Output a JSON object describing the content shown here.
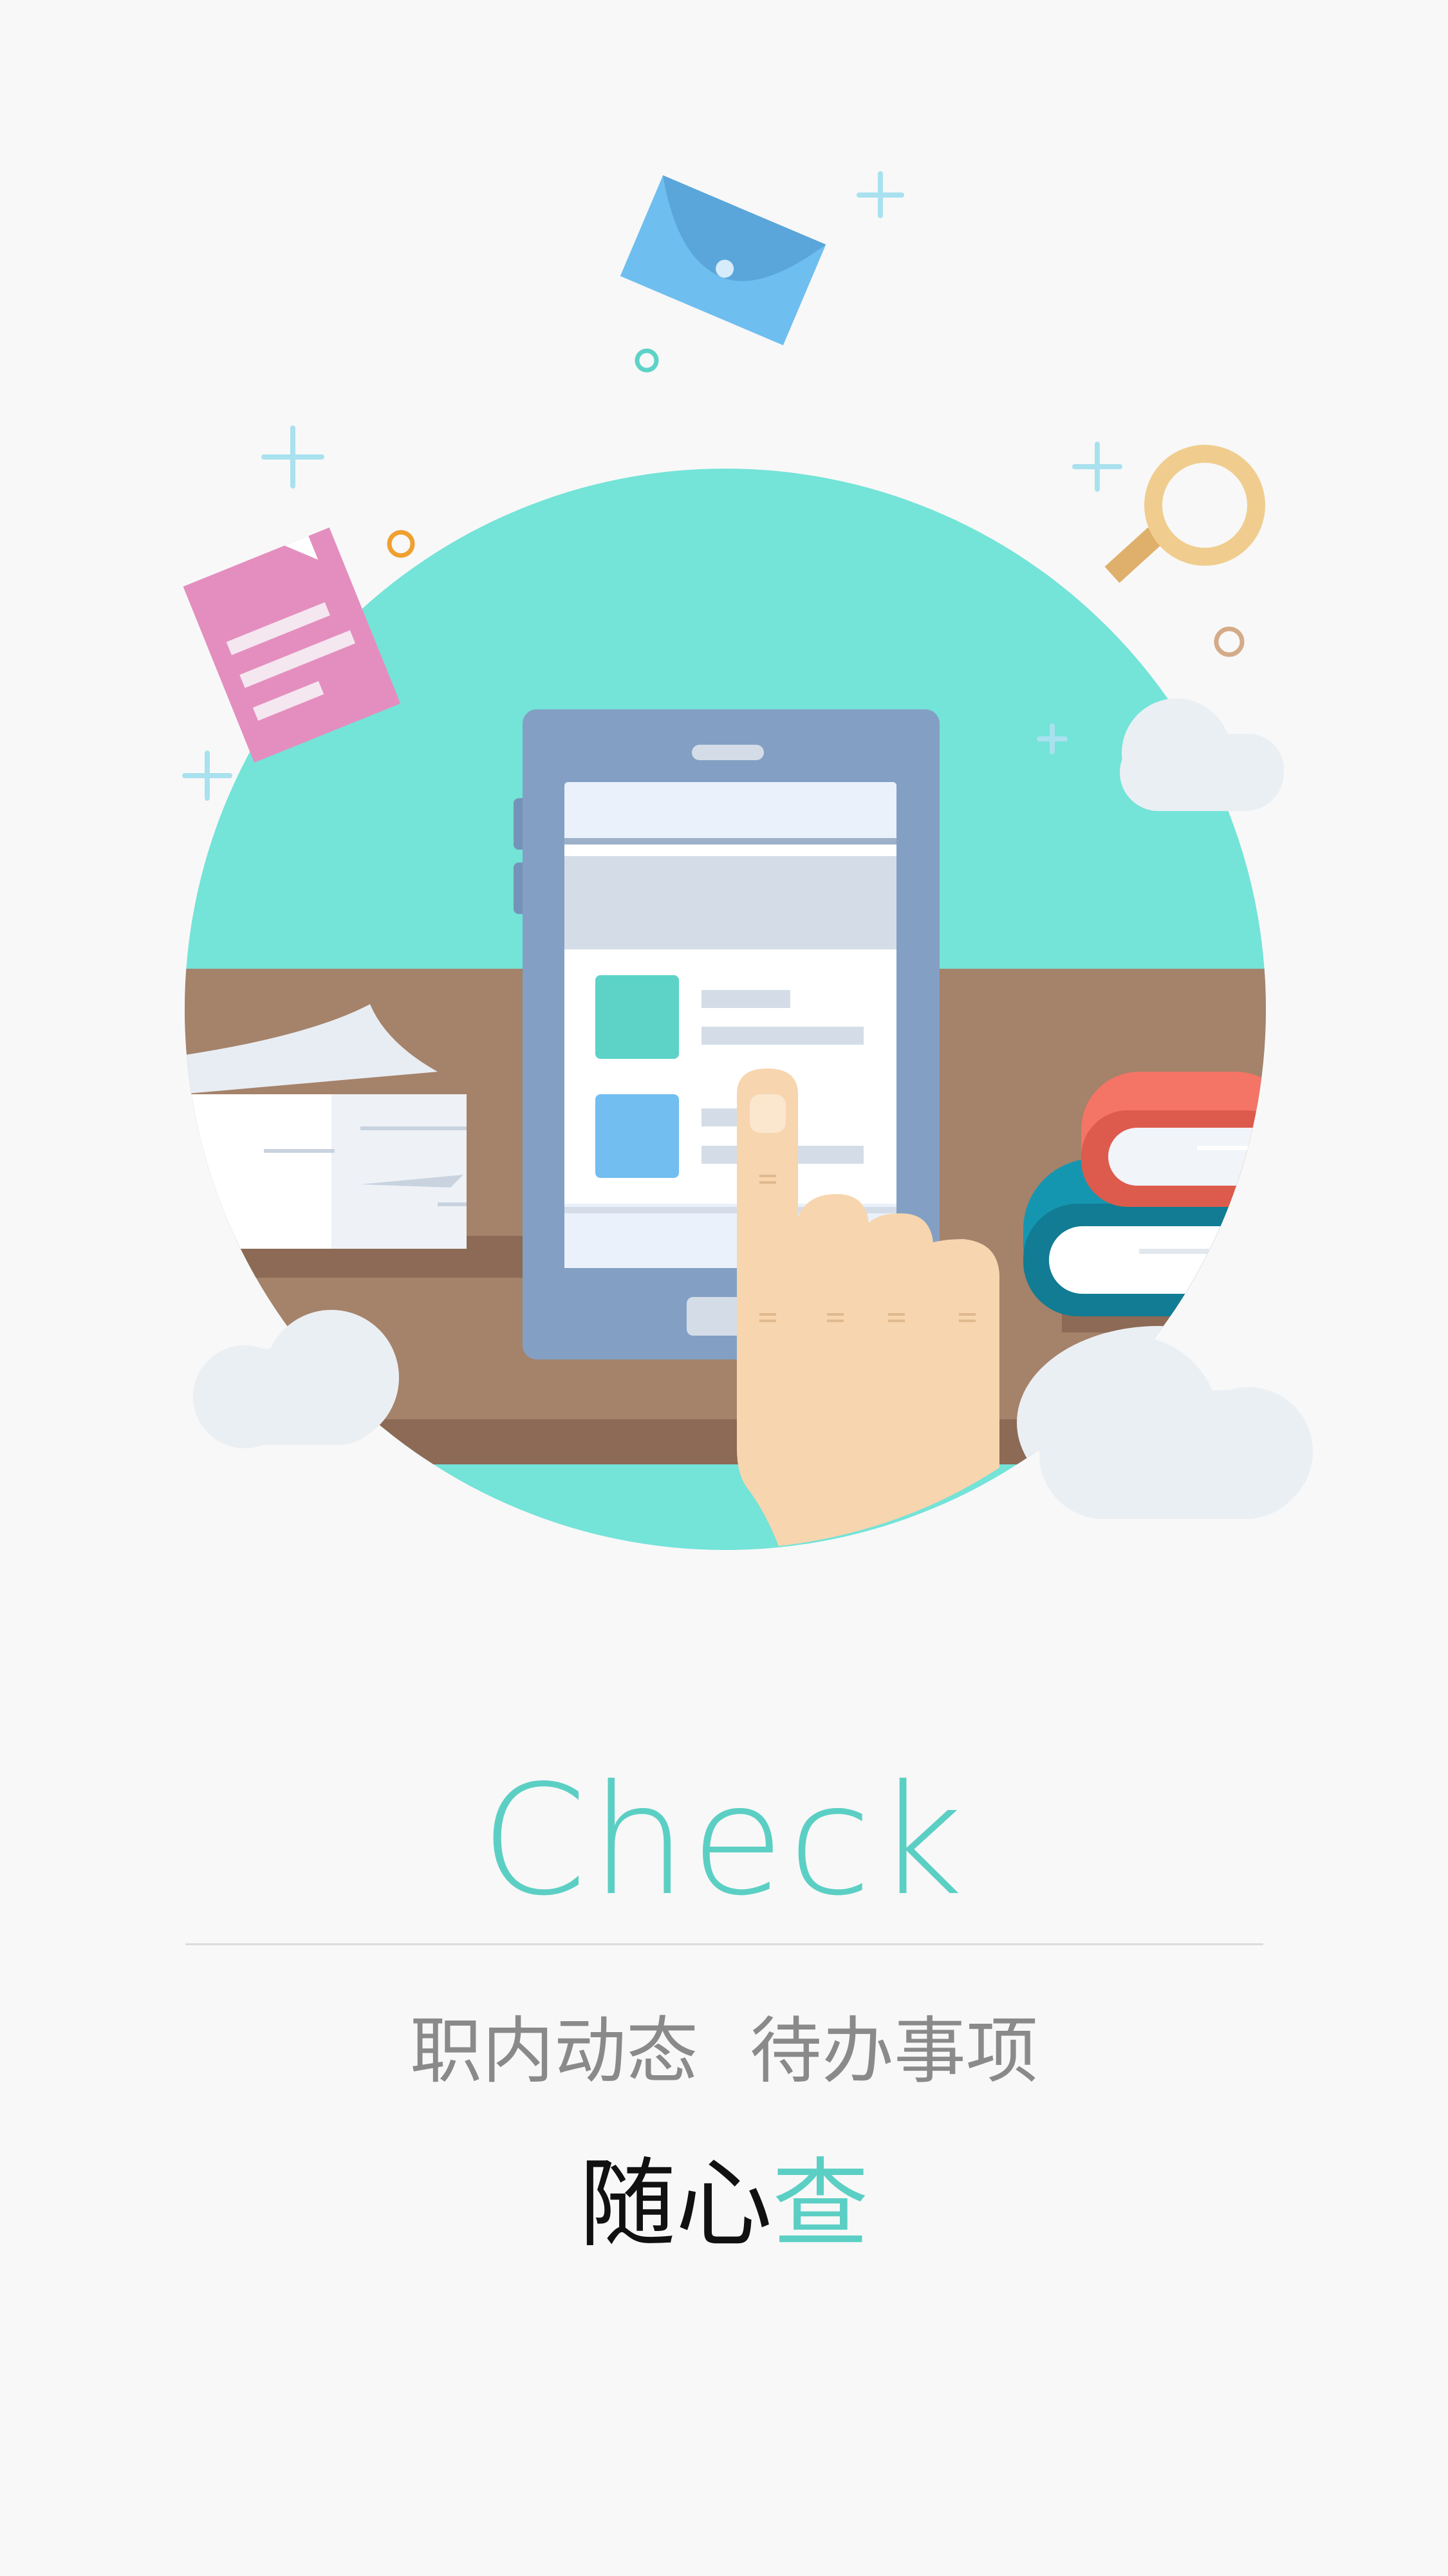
{
  "illustration": {
    "icons": [
      "envelope-icon",
      "document-icon",
      "magnifier-icon",
      "smartphone-icon",
      "pointing-hand-icon",
      "books-icon",
      "cloud-icon",
      "plus-sparkle-icon"
    ],
    "colors": {
      "circle": "#74e3d8",
      "desk": "#a5826a",
      "desk_edge": "#8c6a55",
      "phone": "#83a0c4",
      "hand": "#f7d5ae",
      "envelope": "#6fbef0",
      "document": "#e48ebf",
      "magnifier": "#f0cd8e",
      "book_red": "#f47465",
      "book_teal": "#1596b0",
      "cloud": "#eaeff4"
    }
  },
  "title": "Check",
  "features": [
    "职内动态",
    "待办事项"
  ],
  "slogan": {
    "main": "随心",
    "highlight": "查"
  },
  "accent_color": "#5ccfc4"
}
